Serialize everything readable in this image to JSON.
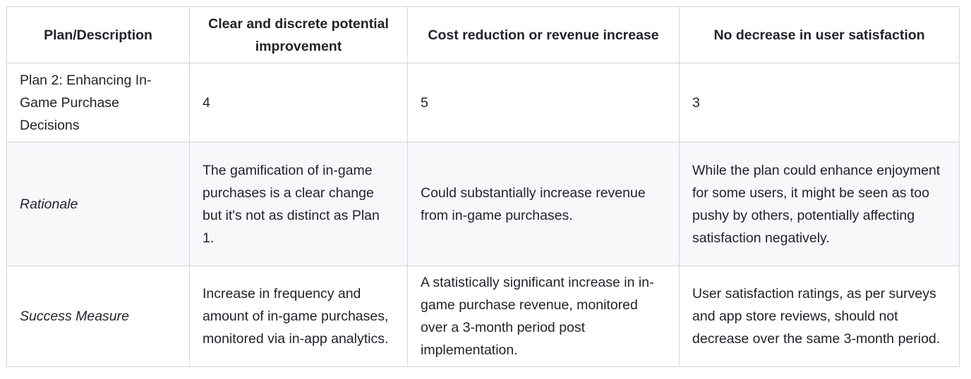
{
  "table": {
    "headers": [
      "Plan/Description",
      "Clear and discrete potential improvement",
      "Cost reduction or revenue increase",
      "No decrease in user satisfaction"
    ],
    "rows": [
      {
        "label": "Plan 2: Enhancing In-Game Purchase Decisions",
        "cells": [
          "4",
          "5",
          "3"
        ]
      },
      {
        "label": "Rationale",
        "cells": [
          "The gamification of in-game purchases is a clear change but it's not as distinct as Plan 1.",
          "Could substantially increase revenue from in-game purchases.",
          "While the plan could enhance enjoyment for some users, it might be seen as too pushy by others, potentially affecting satisfaction negatively."
        ]
      },
      {
        "label": "Success Measure",
        "cells": [
          "Increase in frequency and amount of in-game purchases, monitored via in-app analytics.",
          "A statistically significant increase in in-game purchase revenue, monitored over a 3-month period post implementation.",
          "User satisfaction ratings, as per surveys and app store reviews, should not decrease over the same 3-month period."
        ]
      }
    ]
  }
}
